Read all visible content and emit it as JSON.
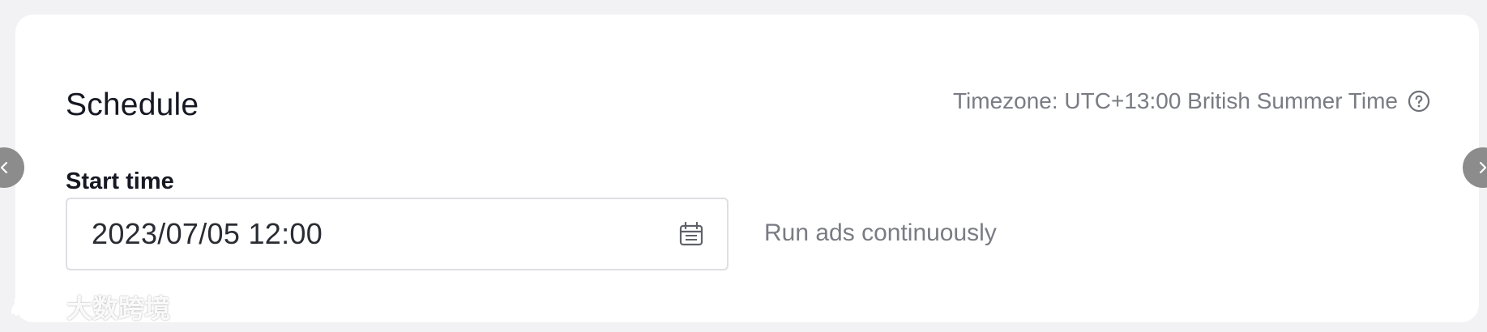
{
  "schedule": {
    "title": "Schedule",
    "timezone_label": "Timezone: UTC+13:00 British Summer Time",
    "start_time_label": "Start time",
    "start_time_value": "2023/07/05 12:00",
    "run_mode_text": "Run ads continuously"
  },
  "icons": {
    "help": "help-circle-icon",
    "calendar": "calendar-icon",
    "prev": "chevron-left-icon",
    "next": "chevron-right-icon"
  },
  "watermark": {
    "text": "大数跨境"
  }
}
